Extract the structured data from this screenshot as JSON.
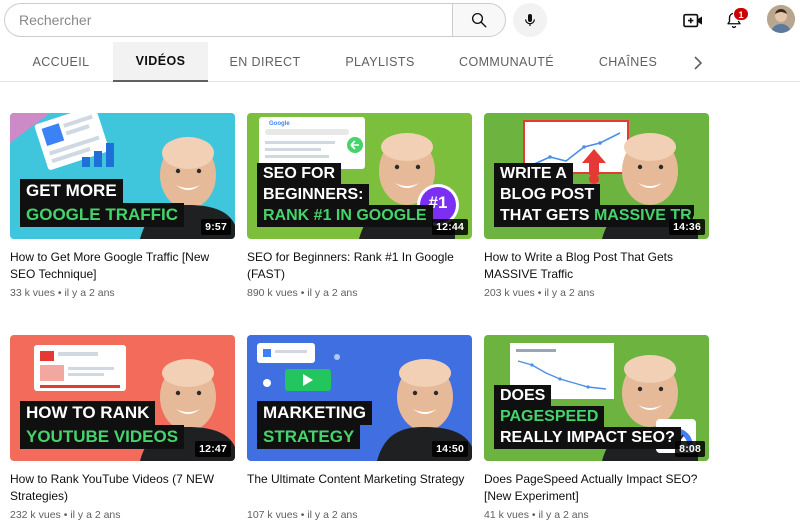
{
  "search": {
    "placeholder": "Rechercher"
  },
  "header": {
    "notification_count": "1"
  },
  "tabs": [
    {
      "label": "ACCUEIL"
    },
    {
      "label": "VIDÉOS"
    },
    {
      "label": "EN DIRECT"
    },
    {
      "label": "PLAYLISTS"
    },
    {
      "label": "COMMUNAUTÉ"
    },
    {
      "label": "CHAÎNES"
    }
  ],
  "videos": [
    {
      "title": "How to Get More Google Traffic [New SEO Technique]",
      "views": "33 k vues",
      "age": "il y a 2 ans",
      "duration": "9:57",
      "thumb_text": [
        "GET MORE",
        "GOOGLE TRAFFIC"
      ],
      "thumb_bg": "#3fc6dd"
    },
    {
      "title": "SEO for Beginners: Rank #1 In Google (FAST)",
      "views": "890 k vues",
      "age": "il y a 2 ans",
      "duration": "12:44",
      "thumb_text": [
        "SEO FOR",
        "BEGINNERS:",
        "RANK #1 IN GOOGLE",
        "#1",
        "Google"
      ],
      "thumb_bg": "#7bbf3c"
    },
    {
      "title": "How to Write a Blog Post That Gets MASSIVE Traffic",
      "views": "203 k vues",
      "age": "il y a 2 ans",
      "duration": "14:36",
      "thumb_text": [
        "WRITE A",
        "BLOG POST",
        "THAT GETS",
        "MASSIVE TRAFFIC"
      ],
      "thumb_bg": "#6cb33f"
    },
    {
      "title": "How to Rank YouTube Videos (7 NEW Strategies)",
      "views": "232 k vues",
      "age": "il y a 2 ans",
      "duration": "12:47",
      "thumb_text": [
        "HOW TO RANK",
        "YOUTUBE VIDEOS"
      ],
      "thumb_bg": "#f26b5b"
    },
    {
      "title": "The Ultimate Content Marketing Strategy",
      "views": "107 k vues",
      "age": "il y a 2 ans",
      "duration": "14:50",
      "thumb_text": [
        "MARKETING",
        "STRATEGY"
      ],
      "thumb_bg": "#3f6fe0"
    },
    {
      "title": "Does PageSpeed Actually Impact SEO? [New Experiment]",
      "views": "41 k vues",
      "age": "il y a 2 ans",
      "duration": "8:08",
      "thumb_text": [
        "DOES",
        "PAGESPEED",
        "REALLY IMPACT SEO?"
      ],
      "thumb_bg": "#6cb33f"
    }
  ],
  "colors": {
    "accent_green": "#46d36b",
    "badge_red": "#cc0000"
  }
}
